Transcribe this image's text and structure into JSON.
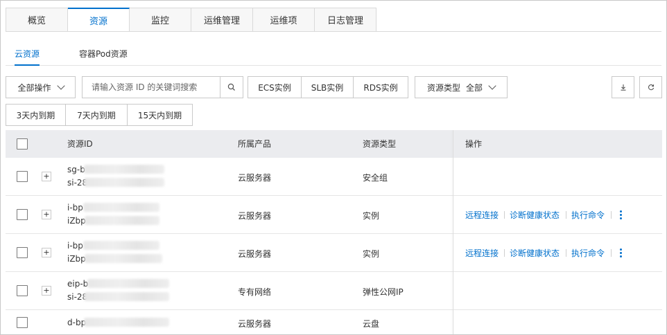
{
  "tabs": [
    "概览",
    "资源",
    "监控",
    "运维管理",
    "运维项",
    "日志管理"
  ],
  "active_tab": "资源",
  "subtabs": [
    "云资源",
    "容器Pod资源"
  ],
  "active_subtab": "云资源",
  "toolbar": {
    "bulk_actions_label": "全部操作",
    "search_placeholder": "请输入资源 ID 的关键词搜索",
    "instance_filters": [
      "ECS实例",
      "SLB实例",
      "RDS实例"
    ],
    "resource_type_label": "资源类型",
    "resource_type_value": "全部",
    "expiry_filters": [
      "3天内到期",
      "7天内到期",
      "15天内到期"
    ]
  },
  "table": {
    "headers": {
      "resource_id": "资源ID",
      "product": "所属产品",
      "resource_type": "资源类型",
      "actions": "操作"
    },
    "rows": [
      {
        "id_line1": "sg-b",
        "id_line2": "si-28",
        "product": "云服务器",
        "type": "安全组",
        "actions": []
      },
      {
        "id_line1": "i-bp",
        "id_line2": "iZbp",
        "product": "云服务器",
        "type": "实例",
        "actions": [
          "远程连接",
          "诊断健康状态",
          "执行命令"
        ]
      },
      {
        "id_line1": "i-bp",
        "id_line2": "iZbp",
        "product": "云服务器",
        "type": "实例",
        "actions": [
          "远程连接",
          "诊断健康状态",
          "执行命令"
        ]
      },
      {
        "id_line1": "eip-b",
        "id_line2": "si-28",
        "product": "专有网络",
        "type": "弹性公网IP",
        "actions": []
      },
      {
        "id_line1": "d-bp",
        "id_line2": "",
        "product": "云服务器",
        "type": "云盘",
        "actions": []
      }
    ]
  },
  "colors": {
    "accent": "#0070cc",
    "header_bg": "#ebecef",
    "border": "#c9c9c9"
  },
  "icons": [
    "chevron-down-icon",
    "search-icon",
    "download-icon",
    "refresh-icon",
    "expand-icon",
    "more-icon"
  ]
}
